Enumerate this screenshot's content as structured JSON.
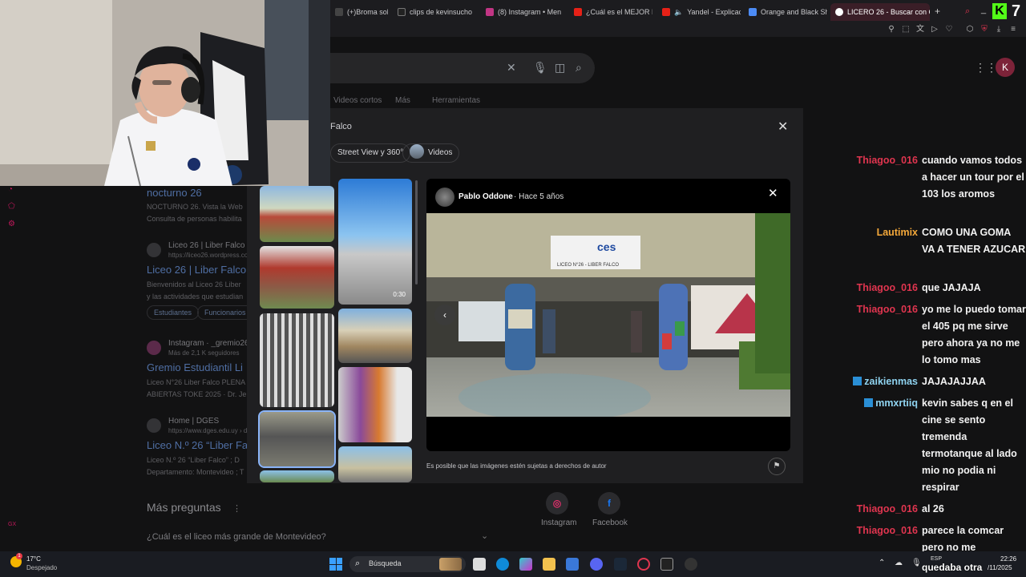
{
  "browser": {
    "tabs": [
      {
        "label": "(+)Broma sobre e",
        "color": "#444"
      },
      {
        "label": "clips de kevinsucho",
        "color": "#222"
      },
      {
        "label": "(8) Instagram • Men",
        "color": "#c13584"
      },
      {
        "label": "¿Cuál es el MEJOR F",
        "color": "#e62117"
      },
      {
        "label": "Yandel - Explicac",
        "color": "#e62117"
      },
      {
        "label": "Orange and Black Sh",
        "color": "#4c8bf5"
      },
      {
        "label": "LICERO 26 - Buscar con G",
        "color": "#ffffff"
      }
    ],
    "new_tab": "+"
  },
  "google": {
    "apps_icon": "grid-icon",
    "avatar_letter": "K",
    "nav": [
      "Videos cortos",
      "Más",
      "Herramientas"
    ],
    "results": [
      {
        "title": "nocturno 26",
        "lines": [
          "NOCTURNO 26. Vista la Web",
          "Consulta de personas habilita"
        ]
      },
      {
        "site": "Liceo 26 | Liber Falco",
        "url": "https://liceo26.wordpress.co",
        "title": "Liceo 26 | Liber Falco",
        "lines": [
          "Bienvenidos al Liceo 26 Liber",
          "y las actividades que estudian"
        ],
        "chips": [
          "Estudiantes",
          "Funcionarios"
        ]
      },
      {
        "site": "Instagram · _gremio26_",
        "url": "Más de 2,1 K seguidores",
        "title": "Gremio Estudiantil Li",
        "lines": [
          "Liceo N°26 Liber Falco PLENA",
          "ABIERTAS TOKE 2025 · Dr. Je"
        ]
      },
      {
        "site": "Home | DGES",
        "url": "https://www.dges.edu.uy › d",
        "title": "Liceo N.º 26 “Liber Fa",
        "lines": [
          "Liceo N.º 26 “Liber Falco” ; D",
          "Departamento: Montevideo ; T"
        ]
      }
    ],
    "more_questions": "Más preguntas",
    "question1": "¿Cuál es el liceo más grande de Montevideo?",
    "social": [
      {
        "label": "Instagram",
        "glyph": "◎",
        "color": "#e1306c"
      },
      {
        "label": "Facebook",
        "glyph": "f",
        "color": "#1877f2"
      }
    ]
  },
  "viewer": {
    "query": "Falco",
    "filters": [
      "Street View y 360°",
      "Videos"
    ],
    "video_duration": "0:30",
    "author": "Pablo Oddone",
    "time": "· Hace 5 años",
    "sign_top": "ces",
    "sign_bottom": "LICEO N°26 - LIBER FALCO",
    "copyright": "Es posible que las imágenes estén sujetas a derechos de autor"
  },
  "chat": [
    {
      "user": "Thiagoo_016",
      "color": "red",
      "text": "cuando vamos todos a hacer un tour por el 103 los aromos",
      "lines": 4
    },
    {
      "user": "Lautimix",
      "color": "orange",
      "text": "COMO UNA GOMA VA A TENER AZUCAR",
      "lines": 3
    },
    {
      "user": "Thiagoo_016",
      "color": "red",
      "text": "que JAJAJA",
      "lines": 1
    },
    {
      "user": "Thiagoo_016",
      "color": "red",
      "text": "yo me lo puedo tomar el 405 pq me sirve pero ahora ya no me lo tomo mas",
      "lines": 4
    },
    {
      "user": "zaikienmas",
      "color": "blue",
      "text": "JAJAJAJJAA",
      "lines": 1
    },
    {
      "user": "mmxrtiiq",
      "color": "blue",
      "text": "kevin sabes q en el cine se sento tremenda termotanque al lado mio no podia ni respirar",
      "lines": 6
    },
    {
      "user": "Thiagoo_016",
      "color": "red",
      "text": "al 26",
      "lines": 1
    },
    {
      "user": "Thiagoo_016",
      "color": "red",
      "text": "parece la comcar pero no me",
      "lines": 2
    }
  ],
  "overlay_text": "quedaba otra",
  "kick": {
    "logo": "K",
    "number": "7"
  },
  "taskbar": {
    "temp": "17°C",
    "weather": "Despejado",
    "search_placeholder": "Búsqueda",
    "lang": "ESP",
    "time": "22:26",
    "date": "/11/2025"
  }
}
